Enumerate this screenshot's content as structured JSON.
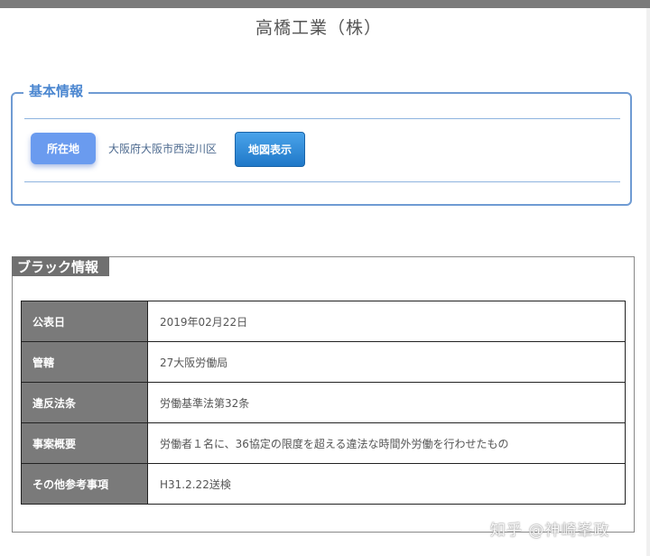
{
  "company": {
    "title": "高橋工業（株）"
  },
  "basic_info": {
    "legend": "基本情報",
    "location_label": "所在地",
    "address": "大阪府大阪市西淀川区",
    "map_button": "地図表示"
  },
  "black_info": {
    "heading": "ブラック情報",
    "rows": [
      {
        "label": "公表日",
        "value": "2019年02月22日"
      },
      {
        "label": "管轄",
        "value": "27大阪労働局"
      },
      {
        "label": "違反法条",
        "value": "労働基準法第32条"
      },
      {
        "label": "事案概要",
        "value": "労働者１名に、36協定の限度を超える違法な時間外労働を行わせたもの"
      },
      {
        "label": "その他参考事項",
        "value": "H31.2.22送検"
      }
    ]
  },
  "watermark": "知乎 @神崎峯政",
  "colors": {
    "accent_blue": "#4a86d0",
    "button_blue": "#6a9bef",
    "map_button": "#1f78c8",
    "header_gray": "#7a7a7a"
  }
}
